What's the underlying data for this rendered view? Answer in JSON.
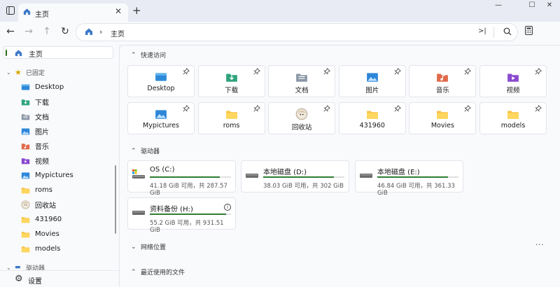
{
  "tab": {
    "title": "主页"
  },
  "address": {
    "crumb": "主页"
  },
  "sidebar": {
    "home": "主页",
    "pinned_header": "已固定",
    "items": [
      {
        "label": "Desktop",
        "icon": "desktop-icon"
      },
      {
        "label": "下载",
        "icon": "download-icon"
      },
      {
        "label": "文档",
        "icon": "document-icon"
      },
      {
        "label": "图片",
        "icon": "pictures-icon"
      },
      {
        "label": "音乐",
        "icon": "music-icon"
      },
      {
        "label": "视频",
        "icon": "video-icon"
      },
      {
        "label": "Mypictures",
        "icon": "pictures-icon"
      },
      {
        "label": "roms",
        "icon": "folder-icon"
      },
      {
        "label": "回收站",
        "icon": "recycle-bin-icon"
      },
      {
        "label": "431960",
        "icon": "folder-icon"
      },
      {
        "label": "Movies",
        "icon": "folder-icon"
      },
      {
        "label": "models",
        "icon": "folder-icon"
      }
    ],
    "drives_header": "驱动器",
    "settings": "设置"
  },
  "main": {
    "quick_access_header": "快速访问",
    "quick_access": [
      {
        "label": "Desktop",
        "icon": "desktop-icon"
      },
      {
        "label": "下载",
        "icon": "download-icon"
      },
      {
        "label": "文档",
        "icon": "document-icon"
      },
      {
        "label": "图片",
        "icon": "pictures-icon"
      },
      {
        "label": "音乐",
        "icon": "music-icon"
      },
      {
        "label": "视频",
        "icon": "video-icon"
      },
      {
        "label": "Mypictures",
        "icon": "pictures-icon"
      },
      {
        "label": "roms",
        "icon": "folder-icon"
      },
      {
        "label": "回收站",
        "icon": "recycle-bin-icon"
      },
      {
        "label": "431960",
        "icon": "folder-icon"
      },
      {
        "label": "Movies",
        "icon": "folder-icon"
      },
      {
        "label": "models",
        "icon": "folder-icon"
      }
    ],
    "drives_header": "驱动器",
    "drives": [
      {
        "name": "OS (C:)",
        "size": "41.18 GiB 可用，共 287.57 GiB",
        "used_fraction": 0.86
      },
      {
        "name": "本地磁盘 (D:)",
        "size": "38.03 GiB 可用，共 302 GiB",
        "used_fraction": 0.87
      },
      {
        "name": "本地磁盘 (E:)",
        "size": "46.84 GiB 可用，共 361.33 GiB",
        "used_fraction": 0.87
      },
      {
        "name": "资料备份 (H:)",
        "size": "55.2 GiB 可用，共 931.51 GiB",
        "used_fraction": 0.94
      }
    ],
    "network_header": "网络位置",
    "recent_header": "最近使用的文件"
  },
  "colors": {
    "accent": "#2f7d32",
    "folder": "#f5c242",
    "star": "#d9a400"
  }
}
